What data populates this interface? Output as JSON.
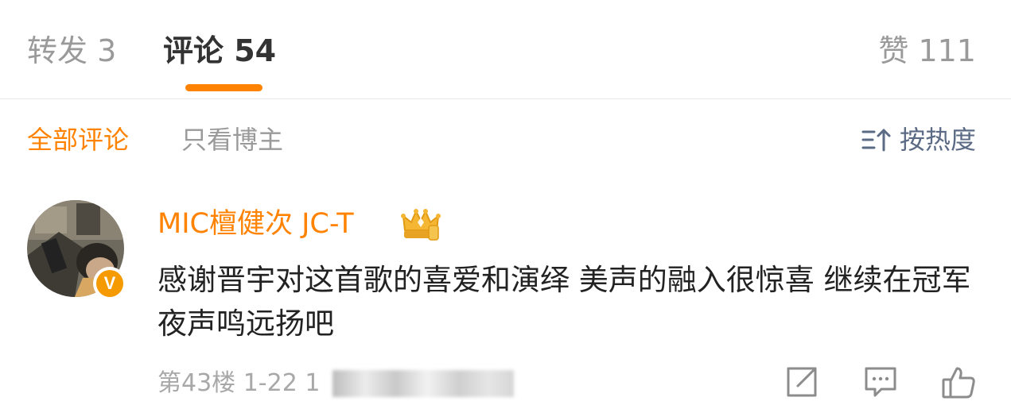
{
  "tabs": {
    "repost_label": "转发 3",
    "comments_label": "评论 54",
    "likes_label": "赞 111"
  },
  "filters": {
    "all_label": "全部评论",
    "op_only_label": "只看博主",
    "sort_label": "按热度",
    "sort_icon": "sort-icon"
  },
  "comment": {
    "username": "MIC檀健次 JC-T",
    "verified_badge": "V",
    "text": "感谢晋宇对这首歌的喜爱和演绎 美声的融入很惊喜 继续在冠军夜声鸣远扬吧",
    "floor_and_date": "第43楼 1-22 1",
    "actions": [
      "share-icon",
      "reply-icon",
      "like-icon"
    ]
  },
  "colors": {
    "accent": "#ff8200",
    "muted": "#9a9a9a",
    "sort_blue": "#5b6b85"
  }
}
